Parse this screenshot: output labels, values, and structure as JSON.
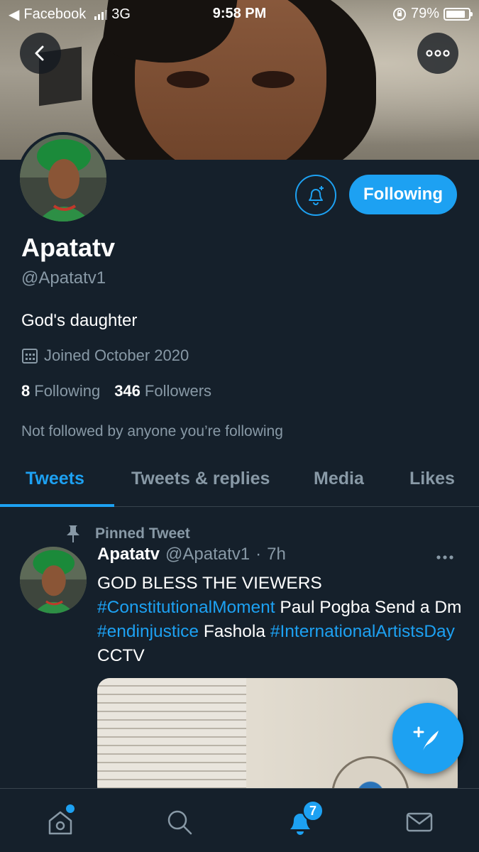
{
  "status_bar": {
    "back_app": "Facebook",
    "network": "3G",
    "time": "9:58 PM",
    "battery": "79%"
  },
  "profile": {
    "display_name": "Apatatv",
    "handle": "@Apatatv1",
    "bio": "God's daughter",
    "joined": "Joined October 2020",
    "following_count": "8",
    "following_label": "Following",
    "followers_count": "346",
    "followers_label": "Followers",
    "follow_context": "Not followed by anyone you’re following",
    "follow_button": "Following"
  },
  "tabs": [
    {
      "label": "Tweets",
      "active": true
    },
    {
      "label": "Tweets & replies",
      "active": false
    },
    {
      "label": "Media",
      "active": false
    },
    {
      "label": "Likes",
      "active": false
    }
  ],
  "pinned_tweet": {
    "pinned_label": "Pinned Tweet",
    "author": "Apatatv",
    "handle": "@Apatatv1",
    "separator": "·",
    "time": "7h",
    "text_1": "GOD BLESS THE VIEWERS",
    "hashtag_1": "#ConstitutionalMoment",
    "text_2": "Paul Pogba Send a Dm",
    "hashtag_2": "#endinjustice",
    "text_3": "Fashola",
    "hashtag_3": "#InternationalArtistsDay",
    "text_4": "CCTV"
  },
  "bottom_nav": {
    "notifications_badge": "7"
  },
  "colors": {
    "background": "#15202b",
    "accent": "#1da1f2",
    "secondary_text": "#8899a6",
    "divider": "#38444d"
  },
  "icons": [
    "back-arrow-icon",
    "more-icon",
    "bell-plus-icon",
    "calendar-icon",
    "pin-icon",
    "compose-icon",
    "home-icon",
    "search-icon",
    "notifications-icon",
    "messages-icon"
  ]
}
